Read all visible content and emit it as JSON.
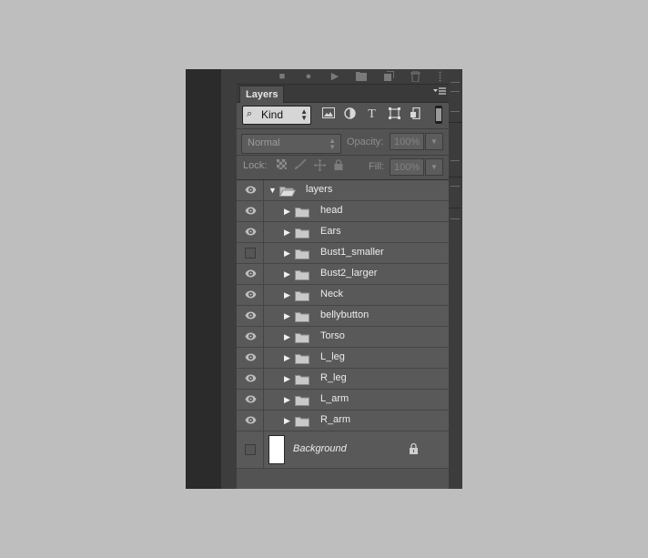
{
  "panel": {
    "tab_label": "Layers",
    "menu_icon": "panel-menu-icon"
  },
  "filter": {
    "kind_label": "Kind",
    "icons": [
      "pixel-filter-icon",
      "adjustment-filter-icon",
      "type-filter-icon",
      "shape-filter-icon",
      "smart-object-filter-icon"
    ]
  },
  "blending": {
    "mode": "Normal",
    "opacity_label": "Opacity:",
    "opacity_value": "100%"
  },
  "lock": {
    "label": "Lock:",
    "fill_label": "Fill:",
    "fill_value": "100%"
  },
  "layers": [
    {
      "name": "layers",
      "type": "group",
      "expanded": true,
      "visible": true,
      "indent": 0
    },
    {
      "name": "head",
      "type": "group",
      "expanded": false,
      "visible": true,
      "indent": 1
    },
    {
      "name": "Ears",
      "type": "group",
      "expanded": false,
      "visible": true,
      "indent": 1
    },
    {
      "name": "Bust1_smaller",
      "type": "group",
      "expanded": false,
      "visible": false,
      "indent": 1
    },
    {
      "name": "Bust2_larger",
      "type": "group",
      "expanded": false,
      "visible": true,
      "indent": 1
    },
    {
      "name": "Neck",
      "type": "group",
      "expanded": false,
      "visible": true,
      "indent": 1
    },
    {
      "name": "bellybutton",
      "type": "group",
      "expanded": false,
      "visible": true,
      "indent": 1
    },
    {
      "name": "Torso",
      "type": "group",
      "expanded": false,
      "visible": true,
      "indent": 1
    },
    {
      "name": "L_leg",
      "type": "group",
      "expanded": false,
      "visible": true,
      "indent": 1
    },
    {
      "name": "R_leg",
      "type": "group",
      "expanded": false,
      "visible": true,
      "indent": 1
    },
    {
      "name": "L_arm",
      "type": "group",
      "expanded": false,
      "visible": true,
      "indent": 1
    },
    {
      "name": "R_arm",
      "type": "group",
      "expanded": false,
      "visible": true,
      "indent": 1
    }
  ],
  "background_layer": {
    "name": "Background",
    "visible": false,
    "locked": true
  }
}
